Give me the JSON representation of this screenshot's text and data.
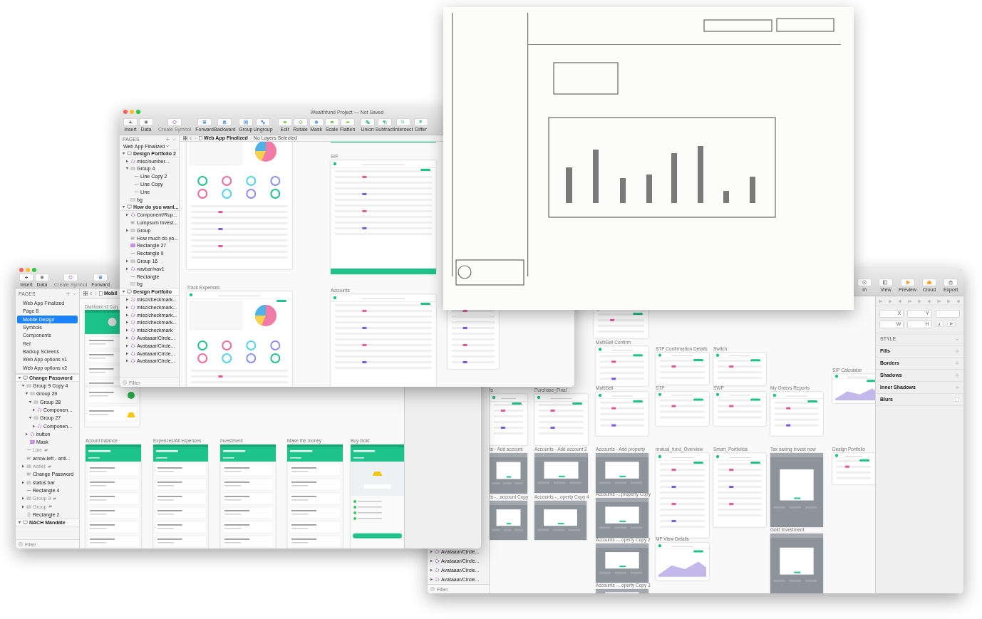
{
  "back_window": {
    "toolbar": [
      {
        "label": "m"
      },
      {
        "label": "View"
      },
      {
        "label": "Preview"
      },
      {
        "label": "Cloud"
      },
      {
        "label": "Export"
      }
    ],
    "layers": [
      {
        "name": "Avataaar/Circle...",
        "kind": "symbol",
        "expanded": false
      },
      {
        "name": "Avataaar/Circle...",
        "kind": "symbol",
        "expanded": false
      },
      {
        "name": "Avataaar/Circle...",
        "kind": "symbol",
        "expanded": false
      },
      {
        "name": "Avataaar/Circle...",
        "kind": "symbol",
        "expanded": false
      }
    ],
    "filter": {
      "placeholder": "Filter"
    },
    "artboards": [
      {
        "kind": "web"
      },
      {
        "title": "MultiSell Confirm",
        "kind": "web"
      },
      {
        "title": "STP Confirmation Details",
        "kind": "web"
      },
      {
        "title": "Switch",
        "kind": "web"
      },
      {
        "title": "SIP Calculator",
        "kind": "web-chart"
      },
      {
        "title": "ts",
        "kind": "web"
      },
      {
        "title": "Purchase_Final",
        "kind": "web"
      },
      {
        "title": "MultiSell",
        "kind": "web"
      },
      {
        "title": "STP",
        "kind": "web"
      },
      {
        "title": "SWP",
        "kind": "web"
      },
      {
        "title": "My Orders Reports",
        "kind": "web"
      },
      {
        "title": "ts - Add account",
        "kind": "modal"
      },
      {
        "title": "Accounts - Add account 2",
        "kind": "modal"
      },
      {
        "title": "Accounts - Add property",
        "kind": "modal"
      },
      {
        "title": "mutual_fund_Overview",
        "kind": "web"
      },
      {
        "title": "Smart_Portfolios",
        "kind": "web"
      },
      {
        "title": "Tax saving Invest now",
        "kind": "modal"
      },
      {
        "title": "Design Portfolio",
        "kind": "web"
      },
      {
        "title": "ts -...account Copy",
        "kind": "modal"
      },
      {
        "title": "Accounts -...operty Copy 4",
        "kind": "modal"
      },
      {
        "title": "Accounts -...property Copy",
        "kind": "modal"
      },
      {
        "title": "MF View Details",
        "kind": "web-chart"
      },
      {
        "title": "Accounts -...operty Copy 2",
        "kind": "modal"
      },
      {
        "title": "Gold Investment",
        "kind": "modal"
      },
      {
        "title": "Accounts -...operty Copy 3",
        "kind": "modal"
      }
    ],
    "inspector": {
      "fields": [
        {
          "label": "X"
        },
        {
          "label": "Y"
        },
        {
          "label": "W"
        },
        {
          "label": "H"
        }
      ],
      "sections": [
        {
          "label": "STYLE",
          "kind": "header"
        },
        {
          "label": "Fills",
          "kind": "add"
        },
        {
          "label": "Borders",
          "kind": "add"
        },
        {
          "label": "Shadows",
          "kind": "add"
        },
        {
          "label": "Inner Shadows",
          "kind": "add"
        },
        {
          "label": "Blurs",
          "kind": "toggle"
        }
      ]
    }
  },
  "middle_window": {
    "toolbar": [
      {
        "label": "Insert",
        "disabled": false
      },
      {
        "label": "Data",
        "disabled": false
      },
      {
        "label": "Create Symbol",
        "disabled": true
      },
      {
        "label": "Forward",
        "disabled": false
      }
    ],
    "pages_header": "PAGES",
    "pages": [
      {
        "label": "Web App Finalized",
        "selected": false
      },
      {
        "label": "Page 8",
        "selected": false
      },
      {
        "label": "Mobile Design",
        "selected": true
      },
      {
        "label": "Symbols",
        "selected": false
      },
      {
        "label": "Components",
        "selected": false
      },
      {
        "label": "Ref",
        "selected": false
      },
      {
        "label": "Backup Screens",
        "selected": false
      },
      {
        "label": "Web App options v1",
        "selected": false
      },
      {
        "label": "Web App options v2",
        "selected": false
      }
    ],
    "layers": [
      {
        "name": "Change Password",
        "kind": "artboard",
        "expanded": true,
        "hidden": false,
        "children": [
          {
            "name": "Group 9 Copy 4",
            "kind": "group",
            "expanded": true,
            "hidden": false,
            "children": [
              {
                "name": "Group 29",
                "kind": "group",
                "expanded": true,
                "hidden": false,
                "children": [
                  {
                    "name": "Group 28",
                    "kind": "group",
                    "expanded": true,
                    "hidden": false,
                    "children": [
                      {
                        "name": "Componen...",
                        "kind": "symbol",
                        "expanded": false,
                        "hidden": false
                      }
                    ]
                  },
                  {
                    "name": "Group 27",
                    "kind": "group",
                    "expanded": true,
                    "hidden": false,
                    "children": [
                      {
                        "name": "Componen...",
                        "kind": "symbol",
                        "expanded": false,
                        "hidden": false
                      }
                    ]
                  }
                ]
              },
              {
                "name": "button",
                "kind": "symbol",
                "expanded": false,
                "hidden": false
              },
              {
                "name": "Mask",
                "kind": "rect",
                "hidden": false
              }
            ]
          },
          {
            "name": "Line",
            "kind": "line",
            "hidden": true
          },
          {
            "name": "arrow-left - anti...",
            "kind": "text",
            "hidden": false
          },
          {
            "name": "wallet",
            "kind": "group",
            "expanded": false,
            "hidden": true
          },
          {
            "name": "Change Password",
            "kind": "text",
            "hidden": false
          },
          {
            "name": "status bar",
            "kind": "group",
            "expanded": false,
            "hidden": false
          },
          {
            "name": "Rectangle 4",
            "kind": "line",
            "hidden": false
          },
          {
            "name": "Group 9",
            "kind": "group",
            "expanded": false,
            "hidden": true
          },
          {
            "name": "Group",
            "kind": "group",
            "expanded": false,
            "hidden": true
          },
          {
            "name": "Rectangle 2",
            "kind": "phone",
            "hidden": false
          }
        ]
      },
      {
        "name": "NACH Mandate",
        "kind": "artboard",
        "expanded": true,
        "hidden": false
      }
    ],
    "filter": {
      "placeholder": "Filter"
    },
    "breadcrumb": {
      "page": "Mobil"
    },
    "artboards": [
      {
        "title": "Dashboard v2 Copy",
        "kind": "mobile-dash"
      },
      {
        "title": "Acount balance",
        "kind": "mobile"
      },
      {
        "title": "Expences/All expences",
        "kind": "mobile"
      },
      {
        "title": "Investment",
        "kind": "mobile"
      },
      {
        "title": "Make the money",
        "kind": "mobile"
      },
      {
        "title": "Buy Gold",
        "kind": "mobile-gold"
      }
    ]
  },
  "front_window": {
    "title": "Wealthfund Project — Not Saved",
    "toolbar": [
      {
        "label": "Insert",
        "disabled": false
      },
      {
        "label": "Data",
        "disabled": false
      },
      {
        "label": "Create Symbol",
        "disabled": true
      },
      {
        "label": "Forward",
        "disabled": false
      },
      {
        "label": "Backward",
        "disabled": false
      },
      {
        "label": "Group",
        "disabled": false
      },
      {
        "label": "Ungroup",
        "disabled": false
      },
      {
        "label": "Edit",
        "disabled": false
      },
      {
        "label": "Rotate",
        "disabled": false
      },
      {
        "label": "Mask",
        "disabled": false
      },
      {
        "label": "Scale",
        "disabled": false
      },
      {
        "label": "Flatten",
        "disabled": false
      },
      {
        "label": "Union",
        "disabled": false
      },
      {
        "label": "Subtract",
        "disabled": false
      },
      {
        "label": "Intersect",
        "disabled": false
      },
      {
        "label": "Differ",
        "disabled": false
      }
    ],
    "pages_header": "PAGES",
    "pages_dropdown": "Web App Finalized",
    "layers": [
      {
        "name": "Design Portfolio 2",
        "kind": "artboard",
        "expanded": true,
        "children": [
          {
            "name": "misc/number...",
            "kind": "symbol",
            "expanded": false
          },
          {
            "name": "Group 4",
            "kind": "group",
            "expanded": true,
            "children": [
              {
                "name": "Line Copy 2",
                "kind": "line"
              },
              {
                "name": "Line Copy",
                "kind": "line"
              },
              {
                "name": "Line",
                "kind": "line"
              }
            ]
          },
          {
            "name": "bg",
            "kind": "shape"
          }
        ]
      },
      {
        "name": "How do you want...",
        "kind": "artboard",
        "expanded": true,
        "children": [
          {
            "name": "Component/Rup...",
            "kind": "symbol",
            "expanded": false
          },
          {
            "name": "Lumpsum Invest...",
            "kind": "text"
          },
          {
            "name": "Group",
            "kind": "group",
            "expanded": false
          },
          {
            "name": "How much do yo...",
            "kind": "text"
          },
          {
            "name": "Rectangle 27",
            "kind": "rect"
          },
          {
            "name": "Rectangle 9",
            "kind": "line"
          },
          {
            "name": "Group 16",
            "kind": "group",
            "expanded": false
          },
          {
            "name": "navbar/nav1",
            "kind": "symbol",
            "expanded": false
          },
          {
            "name": "Rectangle",
            "kind": "line"
          },
          {
            "name": "bg",
            "kind": "shape"
          }
        ]
      },
      {
        "name": "Design Portfolio",
        "kind": "artboard",
        "expanded": true,
        "children": [
          {
            "name": "misc/checkmark...",
            "kind": "symbol",
            "expanded": false
          },
          {
            "name": "misc/checkmark...",
            "kind": "symbol",
            "expanded": false
          },
          {
            "name": "misc/checkmark...",
            "kind": "symbol",
            "expanded": false
          },
          {
            "name": "misc/checkmark...",
            "kind": "symbol",
            "expanded": false
          },
          {
            "name": "misc/checkmark",
            "kind": "symbol",
            "expanded": false
          },
          {
            "name": "Avataaar/Circle...",
            "kind": "symbol",
            "expanded": false
          },
          {
            "name": "Avataaar/Circle...",
            "kind": "symbol",
            "expanded": false
          },
          {
            "name": "Avataaar/Circle...",
            "kind": "symbol",
            "expanded": false
          },
          {
            "name": "Avataaar/Circle...",
            "kind": "symbol",
            "expanded": false
          }
        ]
      }
    ],
    "filter": {
      "placeholder": "Filter"
    },
    "breadcrumb": {
      "page": "Web App Finalized",
      "selection": "No Layers Selected"
    },
    "artboards": [
      {
        "kind": "web-charts"
      },
      {
        "kind": "web-footer"
      },
      {
        "title": "SIP",
        "kind": "web-footer"
      },
      {
        "title": "Track Expenses",
        "kind": "web-charts"
      },
      {
        "title": "Accounts",
        "kind": "web"
      },
      {
        "kind": "web"
      }
    ]
  }
}
